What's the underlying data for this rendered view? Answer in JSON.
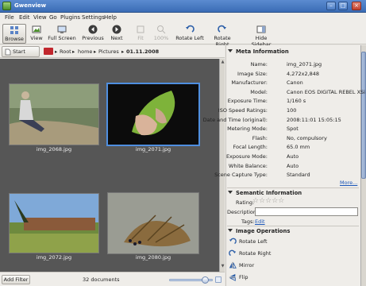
{
  "window": {
    "title": "Gwenview"
  },
  "menu": [
    "File",
    "Edit",
    "View",
    "Go",
    "Plugins",
    "Settings",
    "Help"
  ],
  "toolbar": [
    {
      "label": "Browse",
      "icon": "browse-icon",
      "state": "active"
    },
    {
      "label": "View",
      "icon": "view-icon",
      "state": "normal"
    },
    {
      "label": "Full Screen",
      "icon": "fullscreen-icon",
      "state": "normal"
    },
    {
      "label": "Previous",
      "icon": "previous-icon",
      "state": "normal"
    },
    {
      "label": "Next",
      "icon": "next-icon",
      "state": "normal"
    },
    {
      "label": "Fit",
      "icon": "fit-icon",
      "state": "disabled"
    },
    {
      "label": "100%",
      "icon": "zoom-100-icon",
      "state": "disabled"
    },
    {
      "label": "Rotate Left",
      "icon": "rotate-left-icon",
      "state": "normal"
    },
    {
      "label": "Rotate Right",
      "icon": "rotate-right-icon",
      "state": "normal"
    },
    {
      "label": "Hide Sidebar",
      "icon": "hide-sidebar-icon",
      "state": "normal"
    }
  ],
  "breadcrumb": {
    "start_page": "Start Page",
    "items": [
      "Root",
      "home",
      "Pictures",
      "01.11.2008"
    ]
  },
  "thumbnails": [
    {
      "filename": "img_2068.jpg",
      "selected": false
    },
    {
      "filename": "img_2071.jpg",
      "selected": true
    },
    {
      "filename": "img_2072.jpg",
      "selected": false
    },
    {
      "filename": "img_2080.jpg",
      "selected": false
    }
  ],
  "statusbar": {
    "add_filter": "Add Filter",
    "count": "32 documents",
    "zoom_level": 0.85
  },
  "sidebar": {
    "meta_title": "Meta Information",
    "meta": [
      {
        "label": "Name:",
        "value": "img_2071.jpg"
      },
      {
        "label": "Image Size:",
        "value": "4,272x2,848"
      },
      {
        "label": "Manufacturer:",
        "value": "Canon"
      },
      {
        "label": "Model:",
        "value": "Canon EOS DIGITAL REBEL XSi"
      },
      {
        "label": "Exposure Time:",
        "value": "1/160 s"
      },
      {
        "label": "ISO Speed Ratings:",
        "value": "100"
      },
      {
        "label": "Date and Time (original):",
        "value": "2008:11:01 15:05:15"
      },
      {
        "label": "Metering Mode:",
        "value": "Spot"
      },
      {
        "label": "Flash:",
        "value": "No, compulsory"
      },
      {
        "label": "Focal Length:",
        "value": "65.0 mm"
      },
      {
        "label": "Exposure Mode:",
        "value": "Auto"
      },
      {
        "label": "White Balance:",
        "value": "Auto"
      },
      {
        "label": "Scene Capture Type:",
        "value": "Standard"
      }
    ],
    "more_label": "More...",
    "semantic_title": "Semantic Information",
    "rating_label": "Rating:",
    "rating_stars": "☆☆☆☆☆",
    "description_label": "Description:",
    "description_value": "",
    "tags_label": "Tags:",
    "tags_edit": "Edit",
    "ops_title": "Image Operations",
    "ops": [
      {
        "label": "Rotate Left",
        "icon": "rotate-left-icon"
      },
      {
        "label": "Rotate Right",
        "icon": "rotate-right-icon"
      },
      {
        "label": "Mirror",
        "icon": "mirror-icon"
      },
      {
        "label": "Flip",
        "icon": "flip-icon"
      }
    ]
  }
}
